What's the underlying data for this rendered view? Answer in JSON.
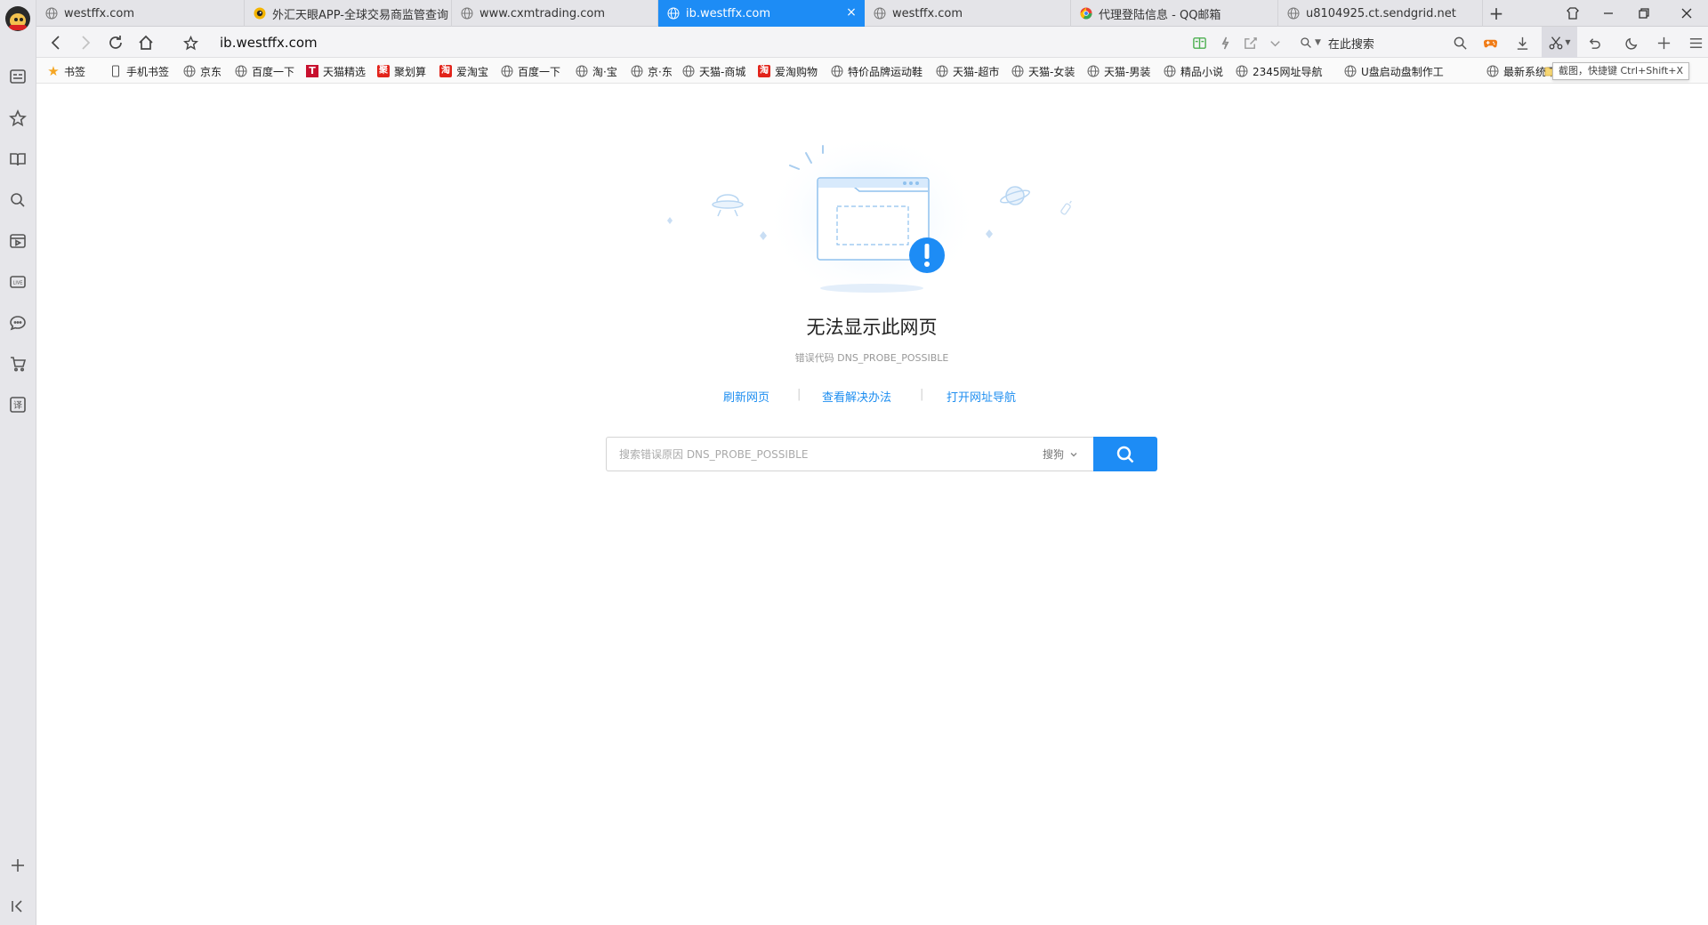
{
  "tabs": [
    {
      "title": "westffx.com",
      "icon": "globe-icon",
      "active": false
    },
    {
      "title": "外汇天眼APP-全球交易商监管查询",
      "icon": "fxeye-logo-icon",
      "active": false
    },
    {
      "title": "www.cxmtrading.com",
      "icon": "globe-icon",
      "active": false
    },
    {
      "title": "ib.westffx.com",
      "icon": "globe-icon",
      "active": true
    },
    {
      "title": "westffx.com",
      "icon": "globe-icon",
      "active": false
    },
    {
      "title": "代理登陆信息 - QQ邮箱",
      "icon": "chrome-style-icon",
      "active": false
    },
    {
      "title": "u8104925.ct.sendgrid.net",
      "icon": "globe-icon",
      "active": false
    }
  ],
  "toolbar": {
    "url": "ib.westffx.com",
    "search_placeholder": "在此搜索"
  },
  "bookmarks": {
    "root": "书签",
    "items": [
      {
        "label": "手机书签",
        "icon": "phone-icon"
      },
      {
        "label": "京东",
        "icon": "globe-icon"
      },
      {
        "label": "百度一下",
        "icon": "globe-icon"
      },
      {
        "label": "天猫精选",
        "icon": "tmall-icon",
        "glyph": "T"
      },
      {
        "label": "聚划算",
        "icon": "juhuasuan-icon",
        "glyph": "聚"
      },
      {
        "label": "爱淘宝",
        "icon": "taobao-icon",
        "glyph": "淘"
      },
      {
        "label": "百度一下",
        "icon": "globe-icon"
      },
      {
        "label": "淘·宝",
        "icon": "globe-icon"
      },
      {
        "label": "京·东",
        "icon": "globe-icon"
      },
      {
        "label": "天猫-商城",
        "icon": "globe-icon"
      },
      {
        "label": "爱淘购物",
        "icon": "taobao-icon",
        "glyph": "淘"
      },
      {
        "label": "特价品牌运动鞋",
        "icon": "globe-icon"
      },
      {
        "label": "天猫-超市",
        "icon": "globe-icon"
      },
      {
        "label": "天猫-女装",
        "icon": "globe-icon"
      },
      {
        "label": "天猫-男装",
        "icon": "globe-icon"
      },
      {
        "label": "精品小说",
        "icon": "globe-icon"
      },
      {
        "label": "2345网址导航",
        "icon": "globe-icon"
      },
      {
        "label": "U盘启动盘制作工",
        "icon": "globe-icon"
      },
      {
        "label": "最新系统下载",
        "icon": "globe-icon"
      }
    ],
    "tooltip": "截图，快捷键 Ctrl+Shift+X"
  },
  "error": {
    "title": "无法显示此网页",
    "code": "错误代码 DNS_PROBE_POSSIBLE",
    "links": [
      "刷新网页",
      "查看解决办法",
      "打开网址导航"
    ],
    "search_placeholder": "搜索错误原因 DNS_PROBE_POSSIBLE",
    "engine": "搜狗"
  },
  "colors": {
    "accent": "#1d8cf5",
    "link": "#1e8ef0"
  }
}
